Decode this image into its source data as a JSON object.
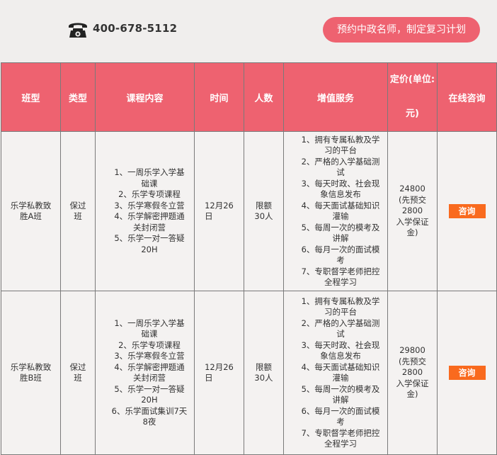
{
  "header": {
    "phone": "400-678-5112",
    "cta": "预约中政名师，制定复习计划"
  },
  "table": {
    "headers": {
      "class_type": "班型",
      "category": "类型",
      "content": "课程内容",
      "time": "时间",
      "capacity": "人数",
      "services": "增值服务",
      "price_a": "定价(单位:",
      "price_b": "元)",
      "consult": "在线咨询"
    },
    "rows": [
      {
        "class_type": [
          "乐学私教致",
          "胜A班"
        ],
        "category": [
          "保过",
          "班"
        ],
        "content": [
          "1、一周乐学入学基",
          "础课",
          "2、乐学专项课程",
          "3、乐学寒假冬立营",
          "4、乐学解密押题通",
          "关封闭营",
          "5、乐学一对一答疑",
          "20H"
        ],
        "time": [
          "12月26",
          "日"
        ],
        "capacity": [
          "限额",
          "30人"
        ],
        "services": [
          "1、拥有专属私教及学",
          "习的平台",
          "2、严格的入学基础测",
          "试",
          "3、每天时政、社会现",
          "象信息发布",
          "4、每天面试基础知识",
          "灌输",
          "5、每周一次的模考及",
          "讲解",
          "6、每月一次的面试模",
          "考",
          "7、专职督学老师把控",
          "全程学习"
        ],
        "price": [
          "24800",
          "(先预交",
          "2800",
          "入学保证",
          "金)"
        ],
        "consult": "咨询"
      },
      {
        "class_type": [
          "乐学私教致",
          "胜B班"
        ],
        "category": [
          "保过",
          "班"
        ],
        "content": [
          "1、一周乐学入学基",
          "础课",
          "2、乐学专项课程",
          "3、乐学寒假冬立营",
          "4、乐学解密押题通",
          "关封闭营",
          "5、乐学一对一答疑",
          "20H",
          "6、乐学面试集训7天",
          "8夜"
        ],
        "time": [
          "12月26",
          "日"
        ],
        "capacity": [
          "限额",
          "30人"
        ],
        "services": [
          "1、拥有专属私教及学",
          "习的平台",
          "2、严格的入学基础测",
          "试",
          "3、每天时政、社会现",
          "象信息发布",
          "4、每天面试基础知识",
          "灌输",
          "5、每周一次的模考及",
          "讲解",
          "6、每月一次的面试模",
          "考",
          "7、专职督学老师把控",
          "全程学习"
        ],
        "price": [
          "29800",
          "(先预交",
          "2800",
          "入学保证",
          "金)"
        ],
        "consult": "咨询"
      }
    ]
  },
  "colors": {
    "header_bg": "#ee6270",
    "consult_button": "#f96a1e",
    "page_bg": "#f0eeed"
  },
  "icons": {
    "phone": "telephone-icon"
  }
}
